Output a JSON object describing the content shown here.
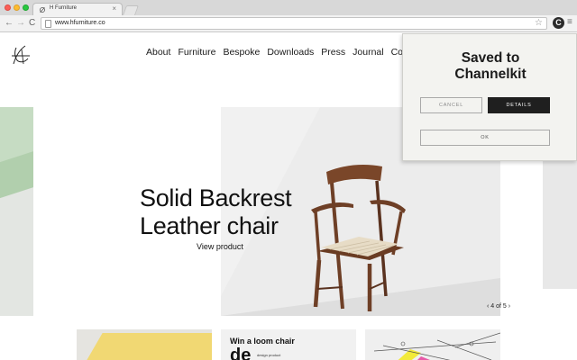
{
  "browser": {
    "tab_title": "H Furniture",
    "tab_close": "×",
    "url": "www.hfurniture.co",
    "back_glyph": "←",
    "forward_glyph": "→",
    "reload_glyph": "C",
    "star_glyph": "☆",
    "extension_glyph": "C",
    "menu_glyph": "≡",
    "icons": [
      "favicon",
      "back-icon",
      "forward-icon",
      "reload-icon",
      "page-icon",
      "bookmark-star-icon",
      "channelkit-extension-icon",
      "menu-icon"
    ]
  },
  "site": {
    "nav": [
      "About",
      "Furniture",
      "Bespoke",
      "Downloads",
      "Press",
      "Journal",
      "Co"
    ],
    "hero": {
      "headline_line1": "Solid Backrest",
      "headline_line2": "Leather chair",
      "link": "View product",
      "counter": "‹ 4 of 5 ›"
    },
    "cards": {
      "loom_title": "Win a loom chair",
      "loom_big": "de",
      "loom_small": "design product"
    }
  },
  "popup": {
    "title_line1": "Saved to",
    "title_line2": "Channelkit",
    "cancel": "CANCEL",
    "details": "DETAILS",
    "ok": "OK"
  },
  "colors": {
    "popup_bg": "#f3f3f0",
    "details_button": "#1f1f1f",
    "chair_wood": "#6e3f26",
    "leather_seat": "#e7dcc6"
  }
}
